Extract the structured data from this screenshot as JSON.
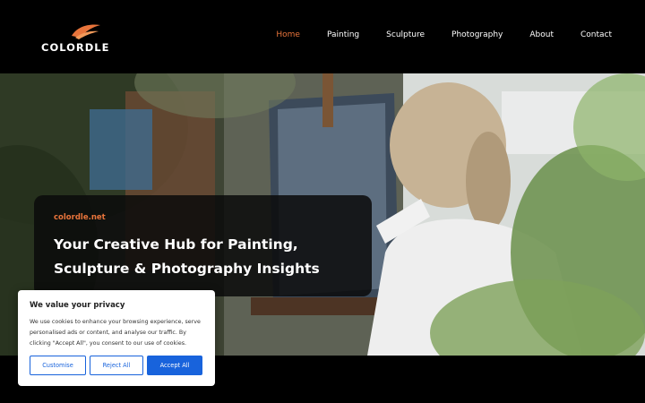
{
  "brand": {
    "name": "COLORDLE",
    "accent": "#e8743b"
  },
  "nav": {
    "items": [
      {
        "label": "Home",
        "active": true
      },
      {
        "label": "Painting",
        "active": false
      },
      {
        "label": "Sculpture",
        "active": false
      },
      {
        "label": "Photography",
        "active": false
      },
      {
        "label": "About",
        "active": false
      },
      {
        "label": "Contact",
        "active": false
      }
    ]
  },
  "hero": {
    "site": "colordle.net",
    "title": "Your Creative Hub for Painting, Sculpture & Photography Insights"
  },
  "cookie": {
    "title": "We value your privacy",
    "text": "We use cookies to enhance your browsing experience, serve personalised ads or content, and analyse our traffic. By clicking \"Accept All\", you consent to our use of cookies.",
    "customise": "Customise",
    "reject": "Reject All",
    "accept": "Accept All",
    "button_color": "#1863dc"
  }
}
